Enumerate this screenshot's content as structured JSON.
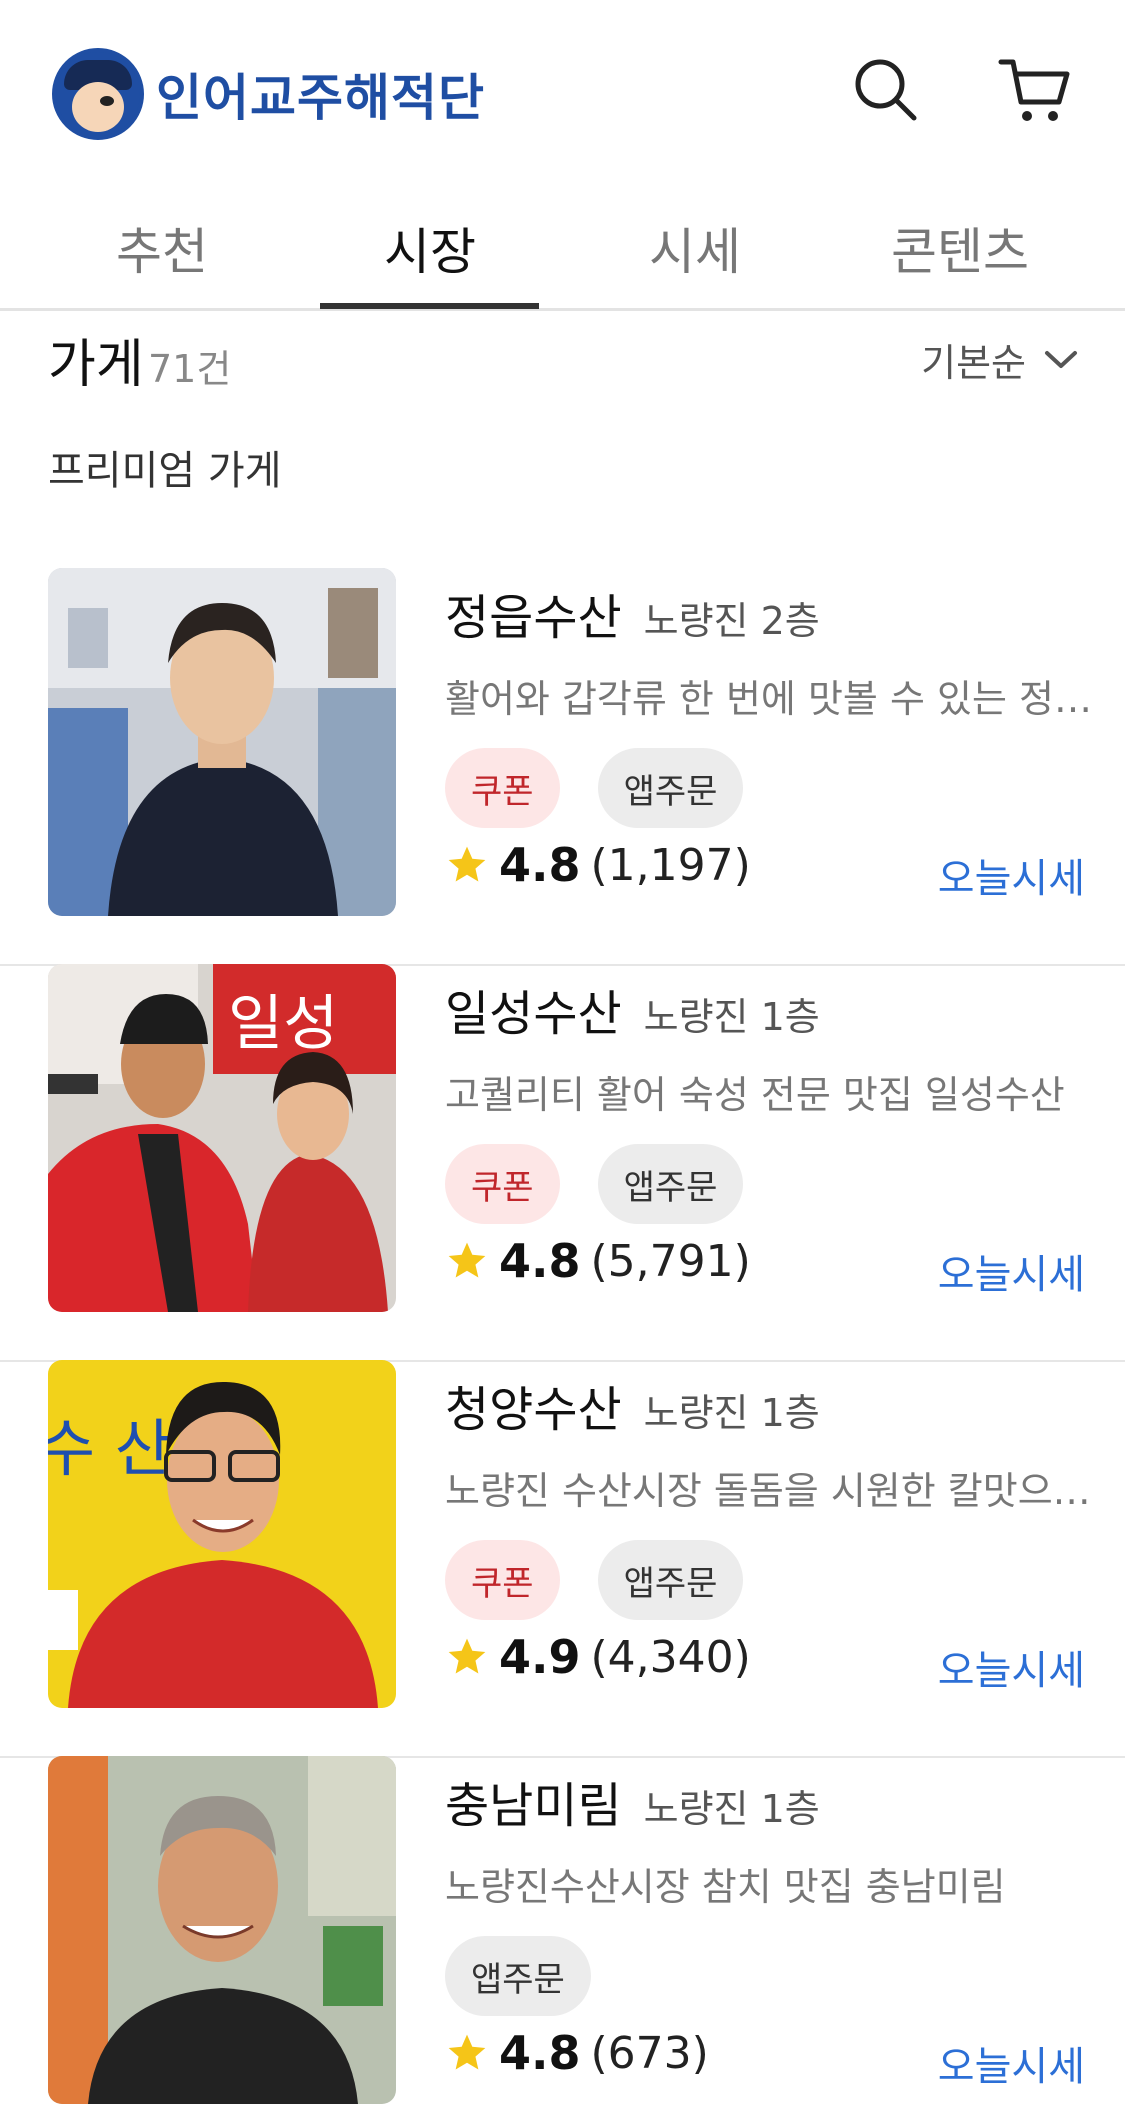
{
  "header": {
    "logo_text": "인어교주해적단",
    "search_icon": "search-icon",
    "cart_icon": "cart-icon"
  },
  "tabs": [
    {
      "label": "추천",
      "active": false
    },
    {
      "label": "시장",
      "active": true
    },
    {
      "label": "시세",
      "active": false
    },
    {
      "label": "콘텐츠",
      "active": false
    }
  ],
  "list": {
    "title": "가게",
    "count": "71건",
    "sort_label": "기본순",
    "section_label": "프리미엄 가게"
  },
  "stores": [
    {
      "name": "정읍수산",
      "floor": "노량진 2층",
      "description": "활어와 갑각류 한 번에 맛볼 수 있는 정…",
      "tags": [
        "쿠폰",
        "앱주문"
      ],
      "rating": "4.8",
      "reviews": "(1,197)",
      "link": "오늘시세"
    },
    {
      "name": "일성수산",
      "floor": "노량진 1층",
      "description": "고퀄리티 활어 숙성 전문 맛집 일성수산",
      "tags": [
        "쿠폰",
        "앱주문"
      ],
      "rating": "4.8",
      "reviews": "(5,791)",
      "link": "오늘시세",
      "sign_text": "일성"
    },
    {
      "name": "청양수산",
      "floor": "노량진 1층",
      "description": "노량진 수산시장 돌돔을 시원한 칼맛으…",
      "tags": [
        "쿠폰",
        "앱주문"
      ],
      "rating": "4.9",
      "reviews": "(4,340)",
      "link": "오늘시세",
      "sign_text": "수 산"
    },
    {
      "name": "충남미림",
      "floor": "노량진 1층",
      "description": "노량진수산시장 참치 맛집 충남미림",
      "tags": [
        "앱주문"
      ],
      "rating": "4.8",
      "reviews": "(673)",
      "link": "오늘시세"
    }
  ],
  "colors": {
    "brand": "#1f4ea3",
    "link": "#2c6fd6",
    "coupon_bg": "#fde6e6",
    "coupon_text": "#c0262b",
    "star": "#f5c518"
  }
}
